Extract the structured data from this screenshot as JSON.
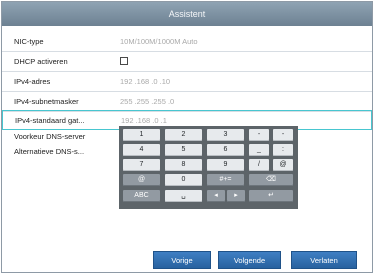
{
  "dialog": {
    "title": "Assistent"
  },
  "fields": [
    {
      "label": "NIC-type",
      "value": "10M/100M/1000M Auto"
    },
    {
      "label": "DHCP activeren",
      "checked": false
    },
    {
      "label": "IPv4-adres",
      "value": "192 .168 .0    .10"
    },
    {
      "label": "IPv4-subnetmasker",
      "value": "255 .255 .255 .0"
    },
    {
      "label": "IPv4-standaard gat...",
      "value": "192 .168 .0    .1"
    },
    {
      "label": "Voorkeur DNS-server"
    },
    {
      "label": "Alternatieve DNS-s..."
    }
  ],
  "keypad": {
    "rows": [
      [
        "1",
        "2",
        "3",
        "-",
        "-"
      ],
      [
        "4",
        "5",
        "6",
        "_",
        ":"
      ],
      [
        "7",
        "8",
        "9",
        "/",
        "@"
      ],
      [
        "@",
        "0",
        "#+=",
        "⌫"
      ],
      [
        "ABC",
        "␣",
        "◂",
        "▸",
        "↵"
      ]
    ]
  },
  "buttons": {
    "previous": "Vorige",
    "next": "Volgende",
    "exit": "Verlaten"
  },
  "colors": {
    "titlebar": "#7b8fa0",
    "button": "#3272b6",
    "active_border": "#48c6d0",
    "keypad_bg": "#5d6469"
  }
}
